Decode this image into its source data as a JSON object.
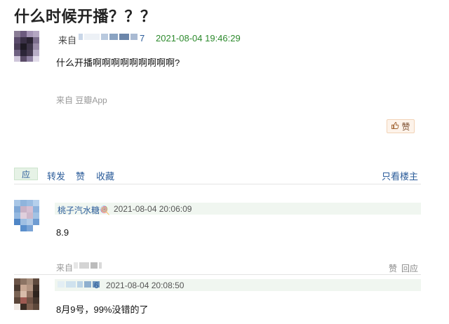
{
  "post": {
    "title": "什么时候开播？？？",
    "source_prefix": "来自",
    "author_suffix": "7",
    "time": "2021-08-04 19:46:29",
    "content": "什么开播啊啊啊啊啊啊啊啊啊?",
    "source_app": "来自 豆瓣App",
    "like_label": "赞"
  },
  "actions": {
    "reply": "应",
    "share": "转发",
    "like": "赞",
    "collect": "收藏",
    "only_op": "只看楼主"
  },
  "comments": [
    {
      "name": "桃子汽水糖🍭",
      "time": "2021-08-04 20:06:09",
      "content": "8.9",
      "source_prefix": "来自",
      "like": "赞",
      "reply": "回应"
    },
    {
      "name_suffix": "6",
      "time": "2021-08-04 20:08:50",
      "content": "8月9号，99%没错的了"
    }
  ],
  "colors": {
    "link": "#2b5c9a",
    "timestamp": "#2d8a2d",
    "comment_bar": "#f0f6f0",
    "like_bg": "#fdf3ea"
  },
  "icons": [
    "thumbs-up-icon"
  ]
}
